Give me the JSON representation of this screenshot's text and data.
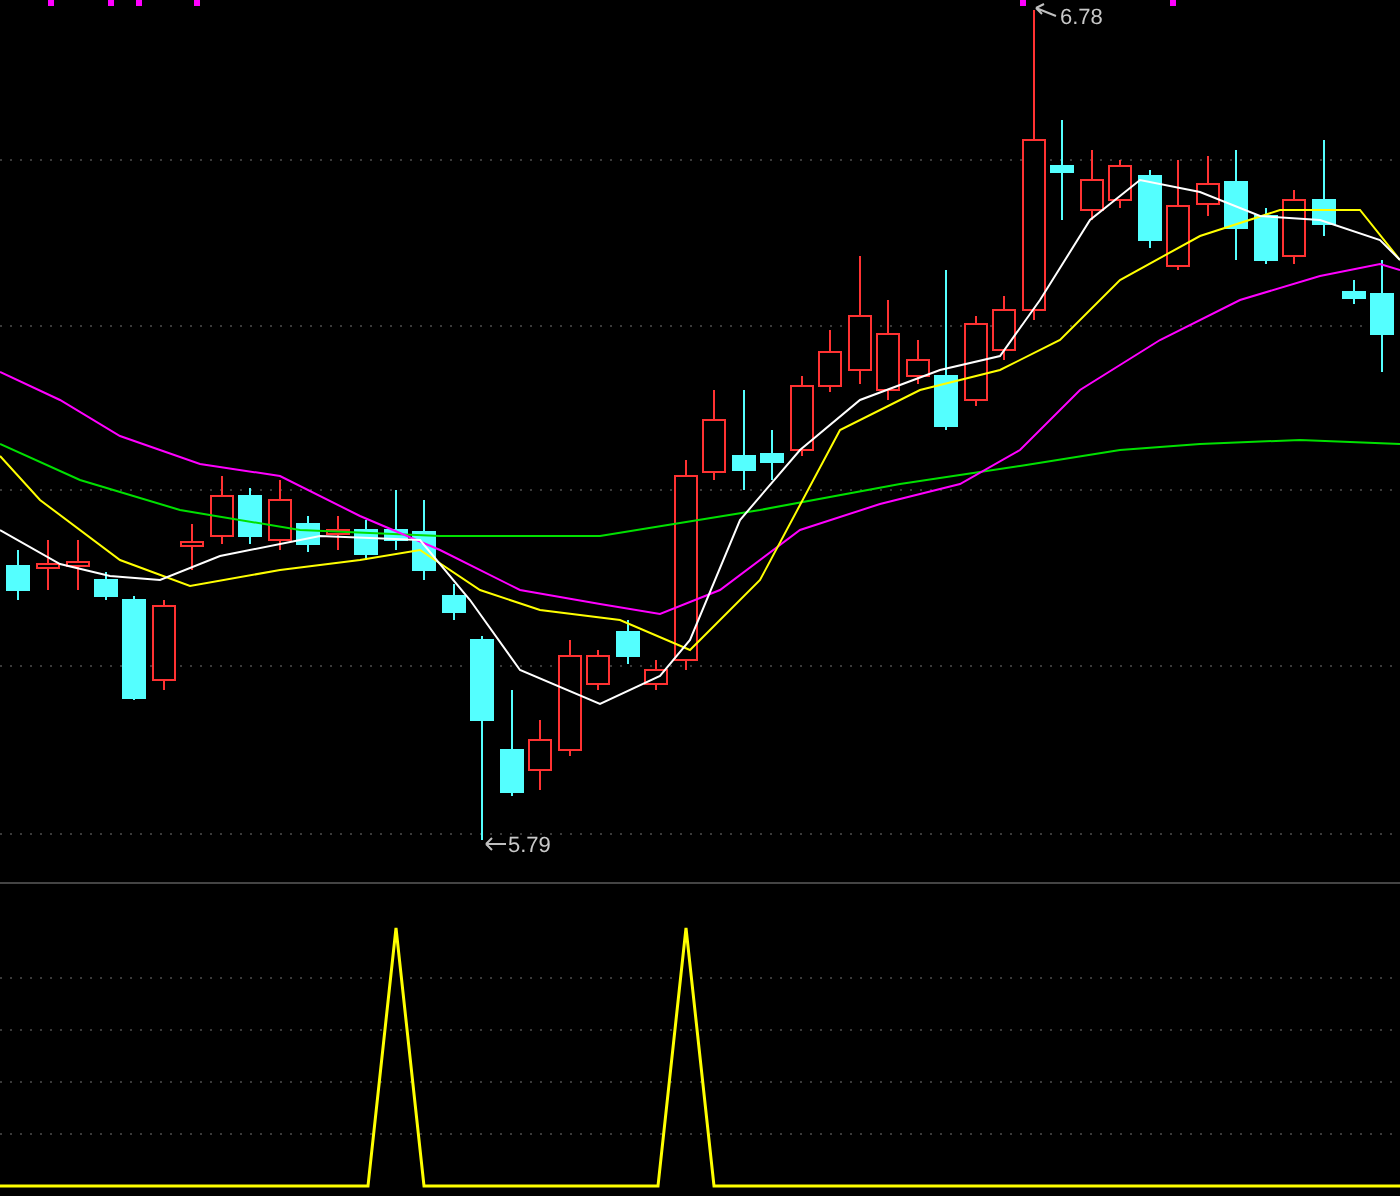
{
  "price_chart": {
    "high_label": "6.78",
    "low_label": "5.79"
  }
}
